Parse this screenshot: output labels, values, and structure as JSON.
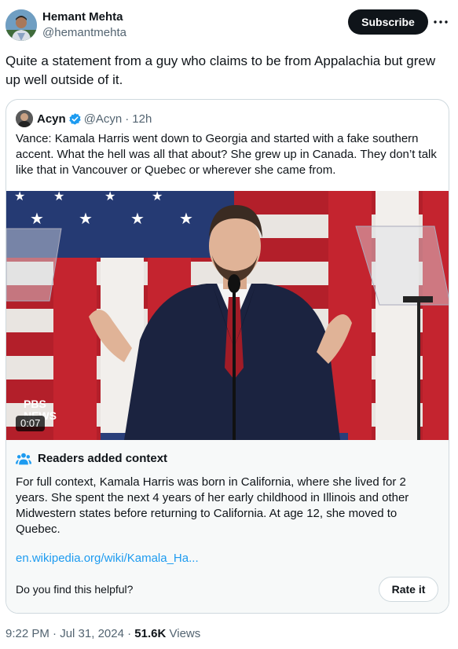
{
  "tweet": {
    "author_name": "Hemant Mehta",
    "author_handle": "@hemantmehta",
    "subscribe_label": "Subscribe",
    "text": "Quite a statement from a guy who claims to be from Appalachia but grew up well outside of it.",
    "time": "9:22 PM",
    "date": "Jul 31, 2024",
    "separator": "·",
    "views_count": "51.6K",
    "views_label": "Views"
  },
  "quote": {
    "name": "Acyn",
    "handle": "@Acyn",
    "separator": "·",
    "time": "12h",
    "text": "Vance: Kamala Harris went down to Georgia and started with a fake southern accent. What the hell was all that about? She grew up in Canada. They don’t talk like that in Vancouver or Quebec or wherever she came from.",
    "video_duration": "0:07",
    "watermark_line1": "PBS",
    "watermark_line2": "NEWS"
  },
  "community_note": {
    "title": "Readers added context",
    "body": "For full context, Kamala Harris was born in California, where she lived for 2 years. She spent the next 4 years of her early childhood in Illinois and other Midwestern states before returning to California. At age 12, she moved to Quebec.",
    "link": "en.wikipedia.org/wiki/Kamala_Ha...",
    "helpful_question": "Do you find this helpful?",
    "rate_label": "Rate it"
  },
  "colors": {
    "text": "#0f1419",
    "secondary": "#536471",
    "link": "#1d9bf0",
    "border": "#cfd9de",
    "note_bg": "#f7f9f9",
    "verified": "#1d9bf0"
  },
  "icons": [
    "more-icon",
    "verified-icon",
    "people-icon"
  ]
}
